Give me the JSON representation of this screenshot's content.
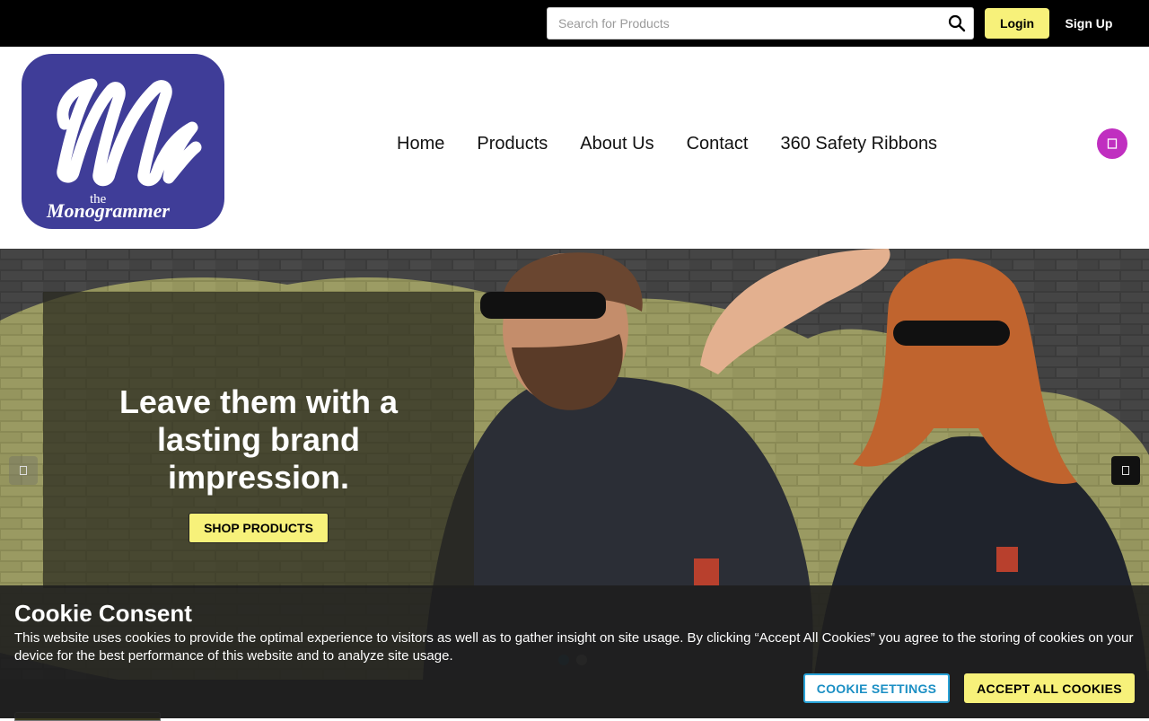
{
  "topbar": {
    "search_placeholder": "Search for Products",
    "login_label": "Login",
    "signup_label": "Sign Up"
  },
  "header": {
    "logo": {
      "letter": "M",
      "small_text": "the",
      "brand_text": "Monogrammer"
    },
    "nav": [
      {
        "label": "Home"
      },
      {
        "label": "Products"
      },
      {
        "label": "About Us"
      },
      {
        "label": "Contact"
      },
      {
        "label": "360 Safety Ribbons"
      }
    ],
    "cart_icon": "cart-icon"
  },
  "hero": {
    "title_line1": "Leave them with a",
    "title_line2": "lasting brand",
    "title_line3": "impression.",
    "button_label": "SHOP PRODUCTS",
    "slide_active": 1,
    "slide_count": 2
  },
  "cookie": {
    "title": "Cookie Consent",
    "text": "This website uses cookies to provide the optimal experience to visitors as well as to gather insight on site usage. By clicking “Accept All Cookies” you agree to the storing of cookies on your device for the best performance of this website and to analyze site usage.",
    "settings_label": "COOKIE SETTINGS",
    "accept_label": "ACCEPT ALL COOKIES"
  },
  "colors": {
    "accent_yellow": "#f7f17a",
    "logo_purple": "#3f3d98",
    "cart_magenta": "#c02fc0",
    "settings_blue": "#29a3d8"
  }
}
